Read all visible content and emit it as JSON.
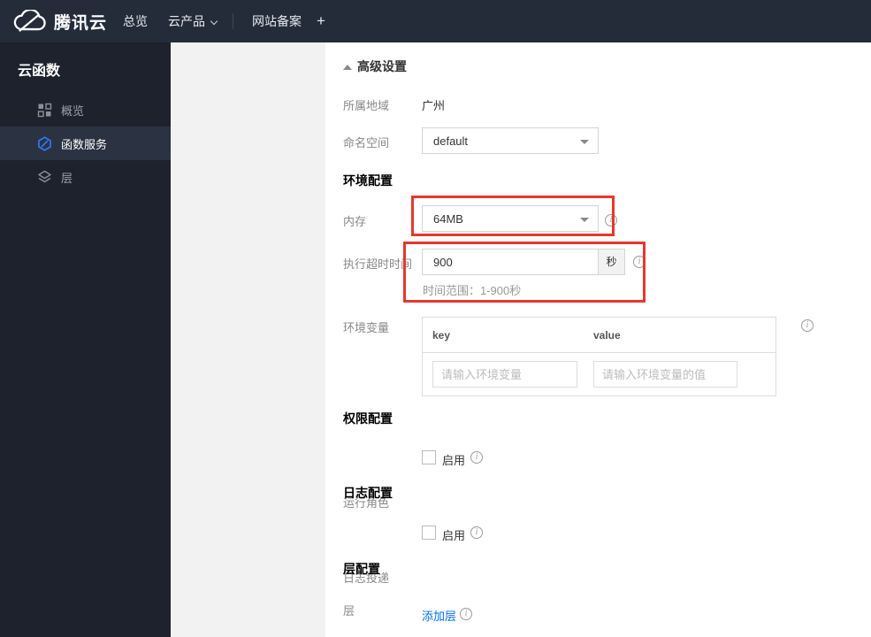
{
  "navbar": {
    "brand": "腾讯云",
    "items": [
      {
        "label": "总览"
      },
      {
        "label": "云产品"
      },
      {
        "label": "网站备案"
      },
      {
        "label": "+"
      }
    ]
  },
  "sidebar": {
    "title": "云函数",
    "items": [
      {
        "label": "概览"
      },
      {
        "label": "函数服务"
      },
      {
        "label": "层"
      }
    ]
  },
  "main": {
    "advanced_settings_label": "高级设置",
    "region": {
      "label": "所属地域",
      "value": "广州"
    },
    "namespace": {
      "label": "命名空间",
      "value": "default"
    },
    "sections": {
      "environment": "环境配置",
      "permission": "权限配置",
      "logging": "日志配置",
      "layer": "层配置"
    },
    "memory": {
      "label": "内存",
      "value": "64MB"
    },
    "timeout": {
      "label": "执行超时时间",
      "value": "900",
      "unit": "秒",
      "hint": "时间范围：1-900秒"
    },
    "env_vars": {
      "label": "环境变量",
      "key_header": "key",
      "value_header": "value",
      "key_placeholder": "请输入环境变量",
      "value_placeholder": "请输入环境变量的值"
    },
    "role": {
      "label": "运行角色",
      "enable_label": "启用"
    },
    "log_delivery": {
      "label": "日志投递",
      "enable_label": "启用"
    },
    "layer": {
      "label": "层",
      "add_link": "添加层"
    }
  },
  "icons": {
    "info_glyph": "i"
  },
  "colors": {
    "navbar_bg": "#242c3a",
    "sidebar_bg": "#1d222d",
    "sidebar_active_bg": "#2b3342",
    "panel_bg": "#f2f2f2",
    "highlight_red": "#e8372c",
    "link_blue": "#006eff",
    "scf_icon_blue": "#2e7bff"
  }
}
